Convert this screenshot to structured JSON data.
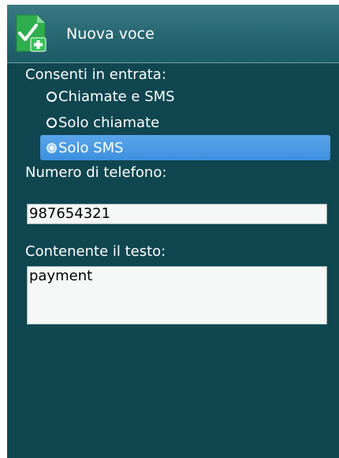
{
  "header": {
    "icon": "checkmark-plus-icon",
    "title": "Nuova voce"
  },
  "incoming": {
    "label": "Consenti in entrata:",
    "options": [
      {
        "label": "Chiamate e SMS",
        "selected": false
      },
      {
        "label": "Solo chiamate",
        "selected": false
      },
      {
        "label": "Solo SMS",
        "selected": true
      }
    ]
  },
  "phone": {
    "label": "Numero di telefono:",
    "value": "987654321"
  },
  "text": {
    "label": "Contenente il testo:",
    "value": "payment"
  },
  "colors": {
    "background": "#0f4650",
    "header": "#2a6a75",
    "selection": "#4a9ae5",
    "icon_green": "#2fae4e"
  }
}
